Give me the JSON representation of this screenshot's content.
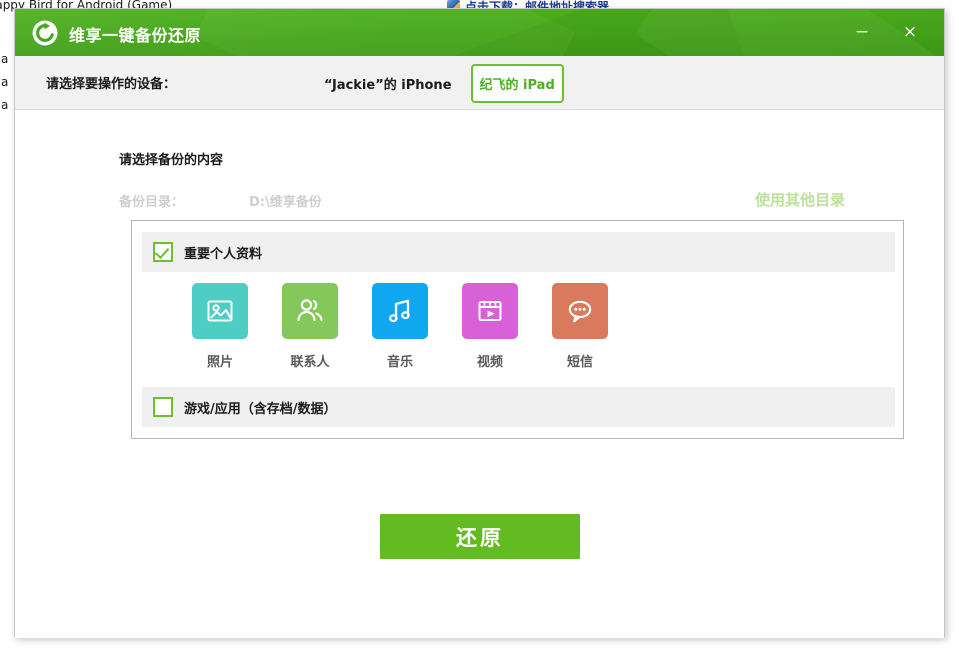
{
  "background": {
    "page_title": "lappy Bird for Android (Game)",
    "line1": "Ha",
    "line2": "Ha",
    "line3": "Ha",
    "promo_text": "点击下载：邮件地址搜索器",
    "promo_icon": "download-icon"
  },
  "window": {
    "title": "维享一键备份还原",
    "logo_icon": "restore-circular-arrow-icon",
    "minimize_label": "−",
    "minimize_icon": "minimize-icon",
    "close_label": "×",
    "close_icon": "close-icon",
    "titlebar_color": "#42a518"
  },
  "device_bar": {
    "prompt": "请选择要操作的设备：",
    "devices": [
      {
        "label": "“Jackie”的 iPhone",
        "selected": false
      },
      {
        "label": "纪飞的 iPad",
        "selected": true
      }
    ],
    "selected_color": "#4caf1f"
  },
  "main": {
    "section_title": "请选择备份的内容",
    "directory_label": "备份目录：",
    "directory_value": "D:\\维享备份",
    "directory_change_link": "使用其他目录",
    "disabled_color": "#cfcfcf",
    "link_color": "#bde09a",
    "groups": [
      {
        "label": "重要个人资料",
        "checked": true
      },
      {
        "label": "游戏/应用（含存档/数据）",
        "checked": false
      }
    ],
    "categories": [
      {
        "label": "照片",
        "icon": "photo-icon",
        "color": "#4ecdc4"
      },
      {
        "label": "联系人",
        "icon": "contacts-icon",
        "color": "#84c martial"
      },
      {
        "label": "音乐",
        "icon": "music-icon",
        "color": "#0fa8f0"
      },
      {
        "label": "视频",
        "icon": "video-icon",
        "color": "#d861d8"
      },
      {
        "label": "短信",
        "icon": "sms-icon",
        "color": "#d9795e"
      }
    ],
    "action_button": "还原",
    "action_button_color": "#62bb20"
  }
}
